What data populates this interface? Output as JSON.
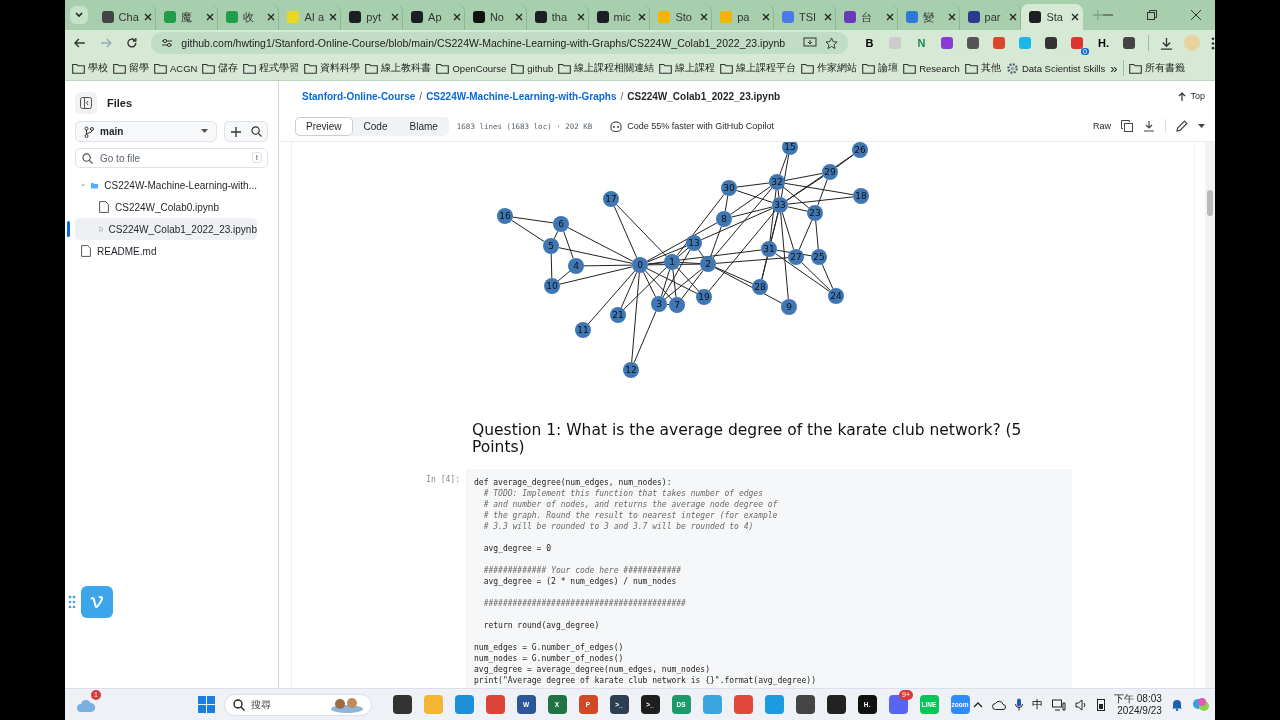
{
  "browser": {
    "tabs": [
      {
        "title": "Cha",
        "kind": "chat",
        "selected": false
      },
      {
        "title": "魔",
        "kind": "sheet",
        "selected": false
      },
      {
        "title": "收",
        "kind": "sheet",
        "selected": false
      },
      {
        "title": "AI a",
        "kind": "zip",
        "selected": false
      },
      {
        "title": "pyt",
        "kind": "github",
        "selected": false
      },
      {
        "title": "Ap",
        "kind": "github",
        "selected": false
      },
      {
        "title": "No",
        "kind": "notion",
        "selected": false
      },
      {
        "title": "tha",
        "kind": "github",
        "selected": false
      },
      {
        "title": "mic",
        "kind": "github",
        "selected": false
      },
      {
        "title": "Sto",
        "kind": "slides",
        "selected": false
      },
      {
        "title": "pa",
        "kind": "slides",
        "selected": false
      },
      {
        "title": "TSI",
        "kind": "doc",
        "selected": false
      },
      {
        "title": "台",
        "kind": "form",
        "selected": false
      },
      {
        "title": "變",
        "kind": "wave",
        "selected": false
      },
      {
        "title": "par",
        "kind": "paper",
        "selected": false
      },
      {
        "title": "Sta",
        "kind": "github",
        "selected": true
      }
    ],
    "address": "github.com/hwting1/Stanford-Online-Course/blob/main/CS224W-Machine-Learning-with-Graphs/CS224W_Colab1_2022_23.ipynb",
    "extensions": [
      {
        "kind": "letter",
        "label": "B"
      },
      {
        "kind": "peak"
      },
      {
        "kind": "letter-green",
        "label": "N"
      },
      {
        "kind": "wand"
      },
      {
        "kind": "chat"
      },
      {
        "kind": "brush"
      },
      {
        "kind": "vimeo"
      },
      {
        "kind": "chevrons"
      },
      {
        "kind": "badge",
        "label": "0"
      },
      {
        "kind": "letter-small",
        "label": "H."
      },
      {
        "kind": "puzzle"
      }
    ],
    "bookmarks": [
      {
        "label": "學校",
        "kind": "folder"
      },
      {
        "label": "留學",
        "kind": "folder"
      },
      {
        "label": "ACGN",
        "kind": "folder"
      },
      {
        "label": "儲存",
        "kind": "folder"
      },
      {
        "label": "程式學習",
        "kind": "folder"
      },
      {
        "label": "資料科學",
        "kind": "folder"
      },
      {
        "label": "線上教科書",
        "kind": "folder"
      },
      {
        "label": "OpenCourse",
        "kind": "folder"
      },
      {
        "label": "github",
        "kind": "folder"
      },
      {
        "label": "線上課程相關連結",
        "kind": "folder"
      },
      {
        "label": "線上課程",
        "kind": "folder"
      },
      {
        "label": "線上課程平台",
        "kind": "folder"
      },
      {
        "label": "作家網站",
        "kind": "folder"
      },
      {
        "label": "論壇",
        "kind": "folder"
      },
      {
        "label": "Research",
        "kind": "folder"
      },
      {
        "label": "其他",
        "kind": "folder"
      },
      {
        "label": "Data Scientist Skills",
        "kind": "page"
      }
    ],
    "bookmarks_overflow": "»",
    "all_bookmarks": "所有書籤"
  },
  "sidebar": {
    "title": "Files",
    "branch": "main",
    "search_placeholder": "Go to file",
    "search_shortcut": "t",
    "tree": [
      {
        "name": "CS224W-Machine-Learning-with...",
        "kind": "folder",
        "expanded": true,
        "selected": false,
        "children": [
          {
            "name": "CS224W_Colab0.ipynb",
            "kind": "file",
            "selected": false
          },
          {
            "name": "CS224W_Colab1_2022_23.ipynb",
            "kind": "file",
            "selected": true
          }
        ]
      },
      {
        "name": "README.md",
        "kind": "file",
        "selected": false
      }
    ]
  },
  "file_header": {
    "breadcrumb": [
      {
        "label": "Stanford-Online-Course",
        "separator": "/"
      },
      {
        "label": "CS224W-Machine-Learning-with-Graphs",
        "separator": "/"
      }
    ],
    "file_name": "CS224W_Colab1_2022_23.ipynb",
    "top": "Top",
    "view_tabs": [
      {
        "label": "Preview",
        "selected": true
      },
      {
        "label": "Code",
        "selected": false
      },
      {
        "label": "Blame",
        "selected": false
      }
    ],
    "file_info": "1683 lines (1683 loc) · 202 KB",
    "copilot": "Code 55% faster with GitHub Copilot",
    "raw": "Raw"
  },
  "notebook": {
    "graph_nodes": [
      "15",
      "26",
      "29",
      "30",
      "32",
      "17",
      "18",
      "16",
      "6",
      "8",
      "33",
      "23",
      "5",
      "13",
      "31",
      "4",
      "0",
      "1",
      "2",
      "27",
      "25",
      "10",
      "3",
      "7",
      "19",
      "28",
      "9",
      "24",
      "11",
      "21",
      "12"
    ],
    "heading": "Question 1: What is the average degree of the karate club network? (5 Points)",
    "cell_prompt": "In [4]:",
    "code_lines": [
      {
        "kind": "code",
        "text": "def average_degree(num_edges, num_nodes):"
      },
      {
        "kind": "comment",
        "text": "  # TODO: Implement this function that takes number of edges"
      },
      {
        "kind": "comment",
        "text": "  # and number of nodes, and returns the average node degree of"
      },
      {
        "kind": "comment",
        "text": "  # the graph. Round the result to nearest integer (for example"
      },
      {
        "kind": "comment",
        "text": "  # 3.3 will be rounded to 3 and 3.7 will be rounded to 4)"
      },
      {
        "kind": "blank"
      },
      {
        "kind": "code",
        "text": "  avg_degree = 0"
      },
      {
        "kind": "blank"
      },
      {
        "kind": "comment",
        "text": "  ############# Your code here ############"
      },
      {
        "kind": "code",
        "text": "  avg_degree = (2 * num_edges) / num_nodes"
      },
      {
        "kind": "blank"
      },
      {
        "kind": "comment",
        "text": "  ##########################################"
      },
      {
        "kind": "blank"
      },
      {
        "kind": "code",
        "text": "  return round(avg_degree)"
      },
      {
        "kind": "blank"
      },
      {
        "kind": "code",
        "text": "num_edges = G.number_of_edges()"
      },
      {
        "kind": "code",
        "text": "num_nodes = G.number_of_nodes()"
      },
      {
        "kind": "code",
        "text": "avg_degree = average_degree(num_edges, num_nodes)"
      },
      {
        "kind": "code",
        "text": "print(\"Average degree of karate club network is {}\".format(avg_degree))"
      }
    ]
  },
  "taskbar": {
    "weather_badge": "1",
    "search_placeholder": "搜尋",
    "apps": [
      {
        "kind": "tile"
      },
      {
        "kind": "folder"
      },
      {
        "kind": "edge"
      },
      {
        "kind": "chrome"
      },
      {
        "kind": "word",
        "label": "W"
      },
      {
        "kind": "excel",
        "label": "X"
      },
      {
        "kind": "ppt",
        "label": "P"
      },
      {
        "kind": "terminal",
        "label": ">_"
      },
      {
        "kind": "terminal-dark",
        "label": ">_"
      },
      {
        "kind": "ide",
        "label": "DS"
      },
      {
        "kind": "notepad"
      },
      {
        "kind": "snip"
      },
      {
        "kind": "sync"
      },
      {
        "kind": "cube"
      },
      {
        "kind": "prism"
      },
      {
        "kind": "letter",
        "label": "H."
      },
      {
        "kind": "discord",
        "badge": "9+"
      },
      {
        "kind": "line",
        "label": "LINE"
      },
      {
        "kind": "zoom",
        "label": "zoom"
      }
    ],
    "ime": "中",
    "time": "下午 08:03",
    "date": "2024/9/23"
  }
}
